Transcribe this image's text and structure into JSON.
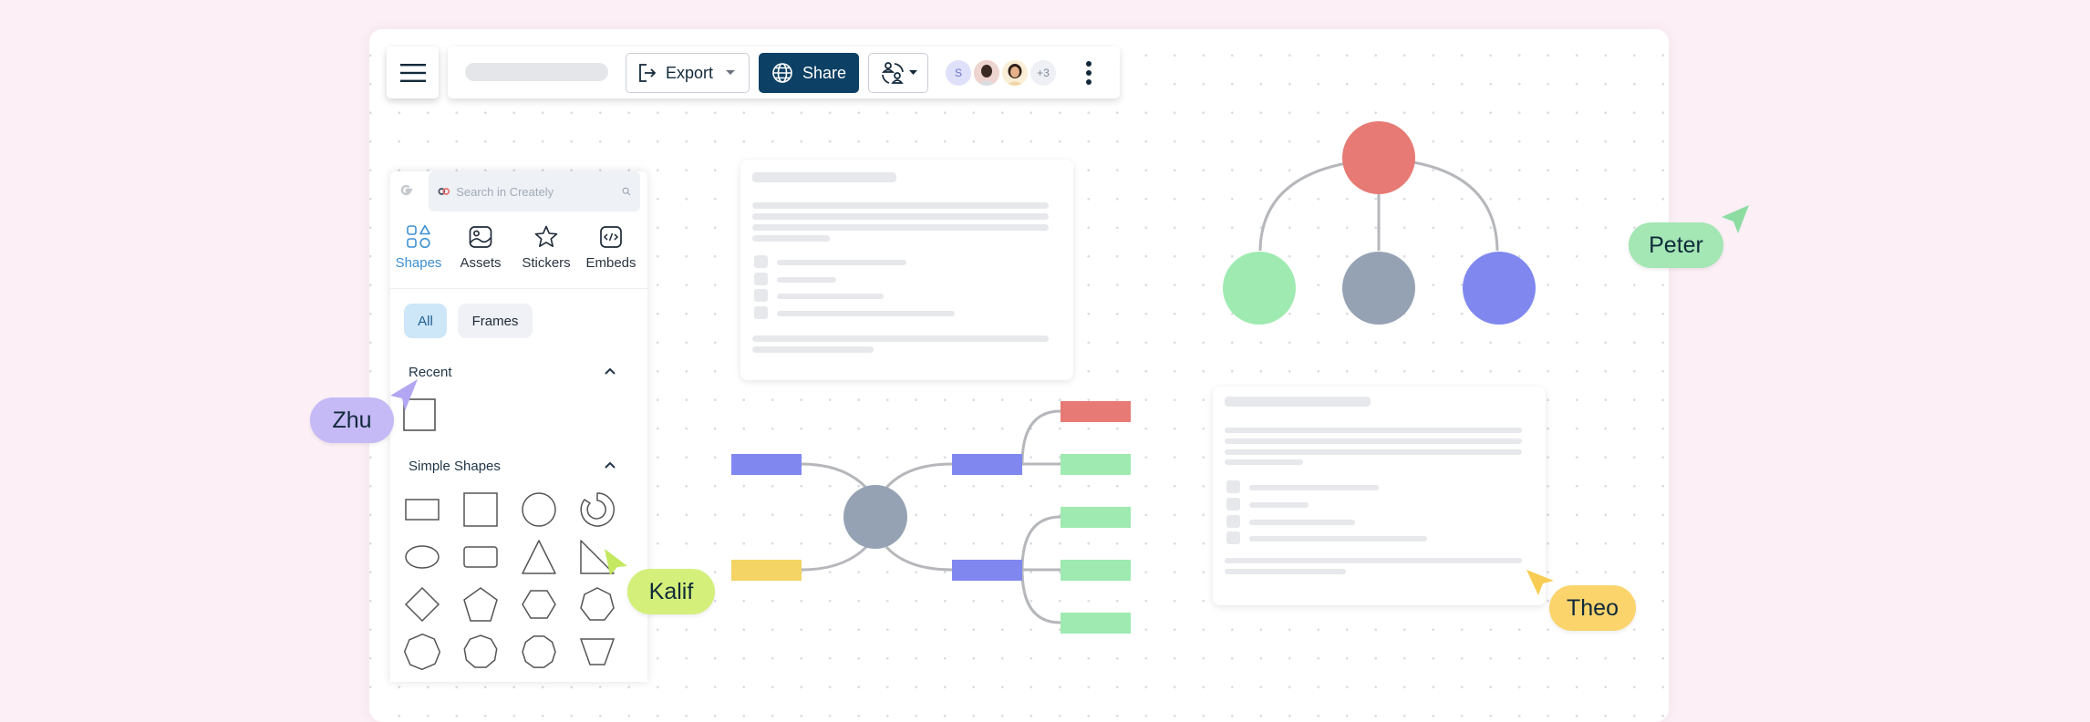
{
  "toolbar": {
    "menu_icon": "hamburger-icon",
    "document_title": "",
    "export": {
      "label": "Export",
      "icon": "export-icon"
    },
    "share": {
      "label": "Share",
      "icon": "globe-icon",
      "color": "#0c4064"
    },
    "collaborate": {
      "icon": "collaborators-sync-icon"
    },
    "avatars": [
      {
        "initial": "S",
        "kind": "initial"
      },
      {
        "initial": "",
        "kind": "photo"
      },
      {
        "initial": "",
        "kind": "photo"
      }
    ],
    "more_count": "+3",
    "more_menu_icon": "kebab-icon"
  },
  "panel": {
    "search": {
      "placeholder": "Search in Creately",
      "value": ""
    },
    "tabs": [
      {
        "label": "Shapes",
        "icon": "shapes-icon",
        "active": true
      },
      {
        "label": "Assets",
        "icon": "image-icon",
        "active": false
      },
      {
        "label": "Stickers",
        "icon": "star-icon",
        "active": false
      },
      {
        "label": "Embeds",
        "icon": "code-icon",
        "active": false
      }
    ],
    "filters": [
      {
        "label": "All",
        "active": true
      },
      {
        "label": "Frames",
        "active": false
      }
    ],
    "sections": [
      {
        "title": "Recent",
        "expanded": true,
        "shapes": [
          "square"
        ]
      },
      {
        "title": "Simple Shapes",
        "expanded": true,
        "shapes": [
          "rectangle",
          "square",
          "circle",
          "donut",
          "ellipse",
          "rounded-rectangle",
          "triangle",
          "right-triangle",
          "diamond",
          "pentagon",
          "hexagon",
          "heptagon",
          "octagon",
          "nonagon",
          "decagon",
          "trapezoid-inverted"
        ]
      }
    ]
  },
  "cursors": [
    {
      "name": "Zhu",
      "color": "#c5b9f6",
      "arrow_color": "#b3a6f3"
    },
    {
      "name": "Kalif",
      "color": "#d4f07a",
      "arrow_color": "#c4e860"
    },
    {
      "name": "Peter",
      "color": "#a4e6b4",
      "arrow_color": "#8ddca2"
    },
    {
      "name": "Theo",
      "color": "#fbd46c",
      "arrow_color": "#f8cc52"
    }
  ],
  "colors": {
    "red": "#e77a74",
    "green": "#9eeab1",
    "gray": "#95a2b3",
    "blue": "#8088ef",
    "yellow": "#f3d464",
    "connector": "#b5b7bb"
  }
}
